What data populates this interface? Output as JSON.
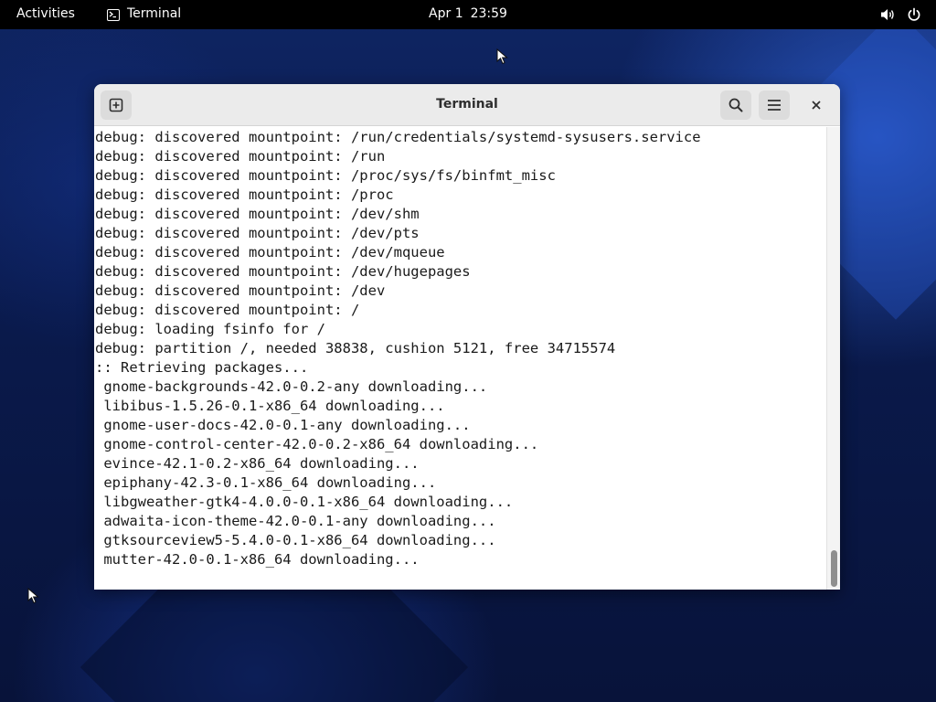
{
  "topbar": {
    "activities_label": "Activities",
    "app_name": "Terminal",
    "clock_date": "Apr 1",
    "clock_time": "23:59",
    "icons": [
      "volume-icon",
      "power-icon"
    ]
  },
  "window": {
    "title": "Terminal",
    "buttons": {
      "new_tab_icon": "new-tab-icon",
      "search_icon": "search-icon",
      "menu_icon": "hamburger-menu-icon",
      "close_icon": "close-icon"
    }
  },
  "terminal": {
    "lines": [
      "debug: discovered mountpoint: /run/credentials/systemd-sysusers.service",
      "debug: discovered mountpoint: /run",
      "debug: discovered mountpoint: /proc/sys/fs/binfmt_misc",
      "debug: discovered mountpoint: /proc",
      "debug: discovered mountpoint: /dev/shm",
      "debug: discovered mountpoint: /dev/pts",
      "debug: discovered mountpoint: /dev/mqueue",
      "debug: discovered mountpoint: /dev/hugepages",
      "debug: discovered mountpoint: /dev",
      "debug: discovered mountpoint: /",
      "debug: loading fsinfo for /",
      "debug: partition /, needed 38838, cushion 5121, free 34715574",
      ":: Retrieving packages...",
      " gnome-backgrounds-42.0-0.2-any downloading...",
      " libibus-1.5.26-0.1-x86_64 downloading...",
      " gnome-user-docs-42.0-0.1-any downloading...",
      " gnome-control-center-42.0-0.2-x86_64 downloading...",
      " evince-42.1-0.2-x86_64 downloading...",
      " epiphany-42.3-0.1-x86_64 downloading...",
      " libgweather-gtk4-4.0.0-0.1-x86_64 downloading...",
      " adwaita-icon-theme-42.0-0.1-any downloading...",
      " gtksourceview5-5.4.0-0.1-x86_64 downloading...",
      " mutter-42.0-0.1-x86_64 downloading..."
    ]
  }
}
